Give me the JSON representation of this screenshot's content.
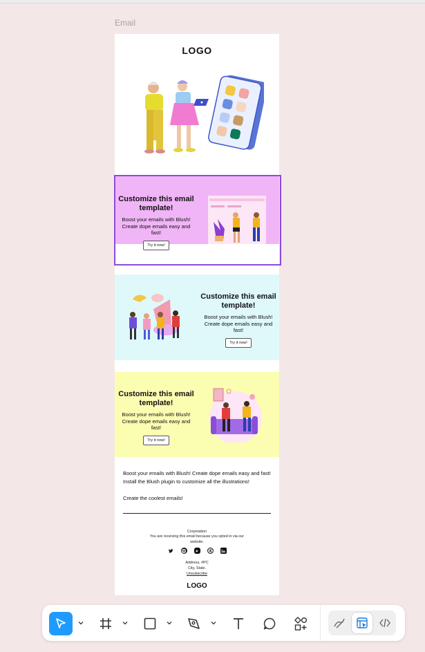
{
  "frame": {
    "label": "Email"
  },
  "email": {
    "logo_top": "LOGO",
    "blocks": [
      {
        "headline": "Customize this email template!",
        "body": "Boost your emails with Blush! Create dope emails easy and fast!",
        "button": "Try it now!"
      },
      {
        "headline": "Customize this email template!",
        "body": "Boost your emails with Blush! Create dope emails easy and fast!",
        "button": "Try it now!"
      },
      {
        "headline": "Customize this email template!",
        "body": "Boost your emails with Blush! Create dope emails easy and fast!",
        "button": "Try it now!"
      }
    ],
    "paragraph1": "Boost your emails with Blush! Create dope emails easy and fast! Install the Blush plugin to customize all the illustrations!",
    "paragraph2": "Create the coolest emails!",
    "footer": {
      "company": "Corporation",
      "notice": "You are receiving this email because you opted in via our website.",
      "social_icons": [
        "twitter-icon",
        "instagram-icon",
        "youtube-icon",
        "dribbble-icon",
        "linkedin-icon"
      ],
      "address_line1": "Address, #PC",
      "address_line2": "City, State.",
      "unsubscribe": "Unsubscribe"
    },
    "logo_bottom": "LOGO"
  },
  "colors": {
    "canvas": "#f4e7e7",
    "block1": "#f0b5f6",
    "block2": "#dff9fb",
    "block3": "#fbfdb1",
    "selection": "#8c4bd9",
    "active_tool": "#1f9bff"
  },
  "toolbar": {
    "tools": [
      "move-tool",
      "frame-tool",
      "rectangle-tool",
      "pen-tool",
      "text-tool",
      "comment-tool",
      "actions-tool"
    ],
    "modes": [
      "draw-mode",
      "design-mode",
      "dev-mode"
    ],
    "active_tool": "move-tool",
    "active_mode": "design-mode"
  }
}
